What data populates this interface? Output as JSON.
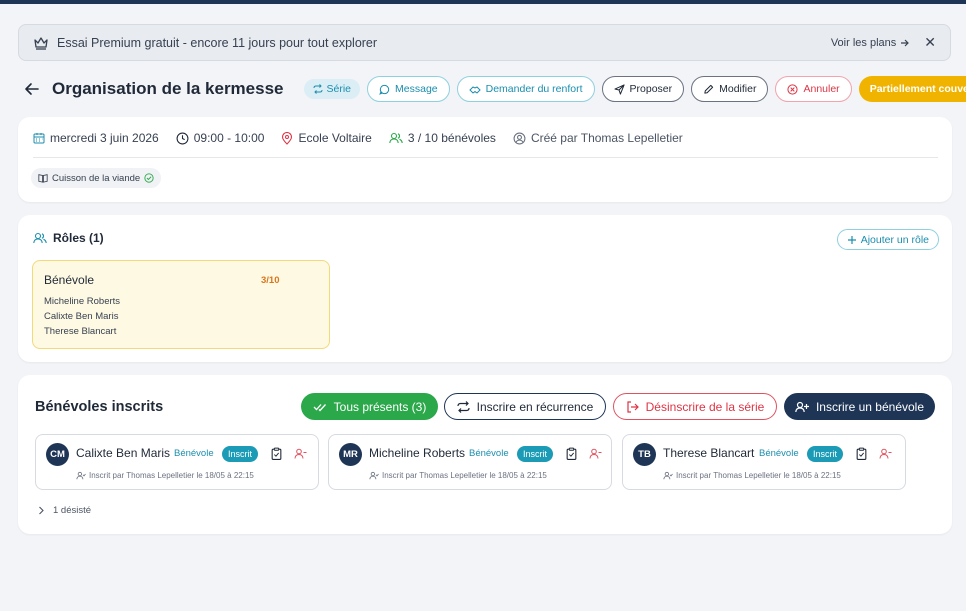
{
  "banner": {
    "icon": "crown-icon",
    "text": "Essai Premium gratuit - encore 11 jours pour tout explorer",
    "plans_label": "Voir les plans",
    "close_label": "✕"
  },
  "header": {
    "title": "Organisation de la kermesse",
    "serie_label": "Série",
    "buttons": {
      "message": "Message",
      "renfort": "Demander du renfort",
      "proposer": "Proposer",
      "modifier": "Modifier",
      "annuler": "Annuler",
      "status": "Partiellement couvert"
    }
  },
  "event": {
    "date": "mercredi 3 juin 2026",
    "time": "09:00 - 10:00",
    "location": "Ecole Voltaire",
    "volunteers": "3 / 10 bénévoles",
    "created_by": "Créé par Thomas Lepelletier",
    "chip": "Cuisson de la viande"
  },
  "roles": {
    "title": "Rôles (1)",
    "add_label": "Ajouter un rôle",
    "items": [
      {
        "name": "Bénévole",
        "count": "3/10",
        "members": [
          "Micheline Roberts",
          "Calixte Ben Maris",
          "Therese Blancart"
        ]
      }
    ]
  },
  "benevoles": {
    "title": "Bénévoles inscrits",
    "btn_present": "Tous présents (3)",
    "btn_recur": "Inscrire en récurrence",
    "btn_desinscrire": "Désinscrire de la série",
    "btn_inscrire": "Inscrire un bénévole",
    "cards": [
      {
        "initials": "CM",
        "name": "Calixte Ben Maris",
        "role": "Bénévole",
        "badge": "Inscrit",
        "meta": "Inscrit par Thomas Lepelletier le 18/05 à 22:15"
      },
      {
        "initials": "MR",
        "name": "Micheline Roberts",
        "role": "Bénévole",
        "badge": "Inscrit",
        "meta": "Inscrit par Thomas Lepelletier le 18/05 à 22:15"
      },
      {
        "initials": "TB",
        "name": "Therese Blancart",
        "role": "Bénévole",
        "badge": "Inscrit",
        "meta": "Inscrit par Thomas Lepelletier le 18/05 à 22:15"
      }
    ],
    "desiste": "1 désisté"
  },
  "colors": {
    "navy": "#1e3556",
    "teal": "#1b8eae",
    "green": "#2aa84a",
    "red": "#dc3545",
    "amber": "#f0b400"
  }
}
